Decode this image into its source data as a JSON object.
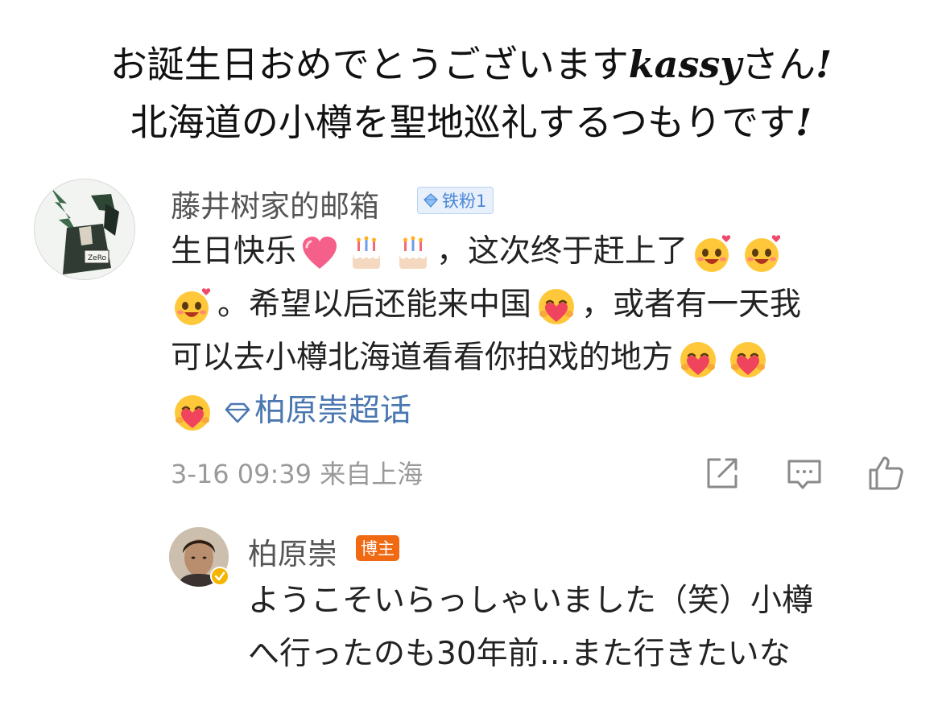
{
  "caption": {
    "line1_prefix": "お誕生日おめでとうございます",
    "line1_name": "kassy",
    "line1_suffix": "さん",
    "line1_bang": "!",
    "line2_text": "北海道の小樽を聖地巡礼するつもりです",
    "line2_bang": "!"
  },
  "comment": {
    "username": "藤井树家的邮箱",
    "fan_badge": "铁粉1",
    "text_1": "生日快乐",
    "text_2": "，这次终于赶上了",
    "text_3": "。希望以后还能来中国",
    "text_4": "，或者有一天我",
    "text_5": "可以去小樽北海道看看你拍戏的地方",
    "topic": "柏原崇超话",
    "timestamp": "3-16 09:39",
    "location": "来自上海",
    "icons": {
      "share": "share-icon",
      "comment": "comment-icon",
      "like": "like-icon"
    }
  },
  "reply": {
    "username": "柏原崇",
    "host_badge": "博主",
    "line1": "ようこそいらっしゃいました（笑）小樽",
    "line2": "へ行ったのも30年前…また行きたいな"
  },
  "colors": {
    "topic_link": "#4a77b0",
    "fan_badge": "#4a86d6",
    "host_badge": "#f06a14",
    "meta_text": "#9a9a9a"
  }
}
